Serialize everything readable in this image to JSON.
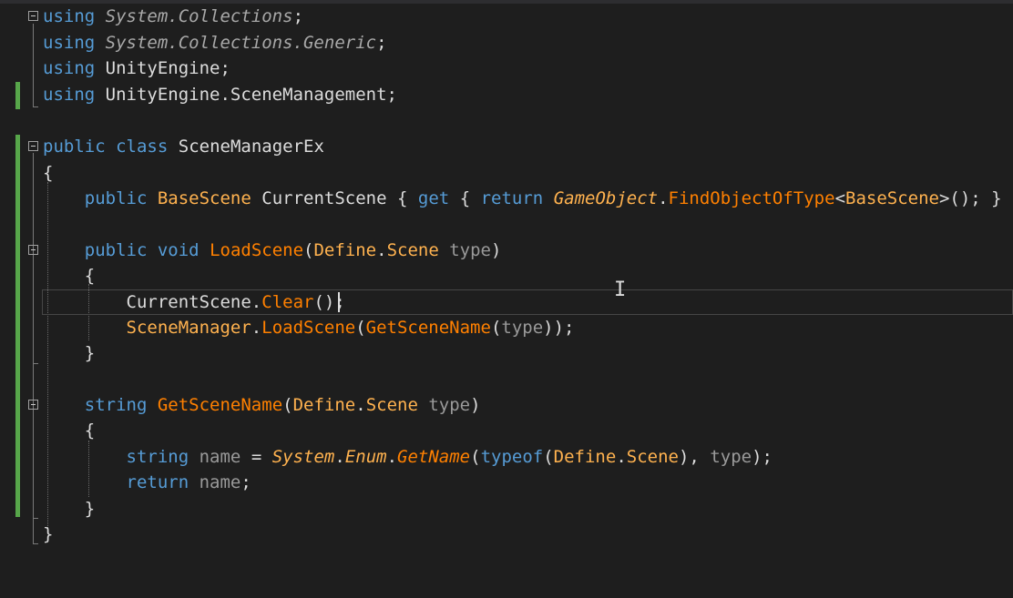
{
  "editor": {
    "lines": {
      "l1": {
        "kw": "using",
        "ns": "System.Collections",
        "end": ";"
      },
      "l2": {
        "kw": "using",
        "ns": "System.Collections.Generic",
        "end": ";"
      },
      "l3": {
        "kw": "using",
        "ns": "UnityEngine",
        "end": ";"
      },
      "l4": {
        "kw": "using",
        "ns": "UnityEngine.SceneManagement",
        "end": ";"
      },
      "l6": {
        "mod": "public",
        "cls": "class",
        "name": "SceneManagerEx"
      },
      "l7": {
        "text": "{"
      },
      "l8": {
        "mod": "public",
        "type": "BaseScene",
        "prop": "CurrentScene",
        "open1": "{",
        "get": "get",
        "open2": "{",
        "ret": "return",
        "obj": "GameObject",
        "dot": ".",
        "method": "FindObjectOfType",
        "lt": "<",
        "gen": "BaseScene",
        "tail": ">(); } }"
      },
      "l10": {
        "mod": "public",
        "void": "void",
        "method": "LoadScene",
        "open": "(",
        "t1": "Define",
        "dot": ".",
        "t2": "Scene",
        "param": "type",
        "close": ")"
      },
      "l11": {
        "text": "{"
      },
      "l12": {
        "obj": "CurrentScene",
        "dot": ".",
        "method": "Clear",
        "tail": "();"
      },
      "l13": {
        "obj": "SceneManager",
        "dot": ".",
        "method": "LoadScene",
        "open": "(",
        "inner": "GetSceneName",
        "open2": "(",
        "param": "type",
        "tail": "));"
      },
      "l14": {
        "text": "}"
      },
      "l16": {
        "type": "string",
        "method": "GetSceneName",
        "open": "(",
        "t1": "Define",
        "dot": ".",
        "t2": "Scene",
        "param": "type",
        "close": ")"
      },
      "l17": {
        "text": "{"
      },
      "l18": {
        "type": "string",
        "var": "name",
        "eq": "=",
        "ns": "System",
        "dot1": ".",
        "cls": "Enum",
        "dot2": ".",
        "method": "GetName",
        "open": "(",
        "typeof": "typeof",
        "open2": "(",
        "t1": "Define",
        "dot3": ".",
        "t2": "Scene",
        "close": "),",
        "param": "type",
        "tail": ");"
      },
      "l19": {
        "ret": "return",
        "var": "name",
        "end": ";"
      },
      "l20": {
        "text": "}"
      },
      "l21": {
        "text": "}"
      }
    }
  },
  "colors": {
    "background": "#1e1e1e",
    "keyword": "#569cd6",
    "type": "#ffb24f",
    "method": "#ff8000",
    "change_bar": "#57a64a"
  }
}
